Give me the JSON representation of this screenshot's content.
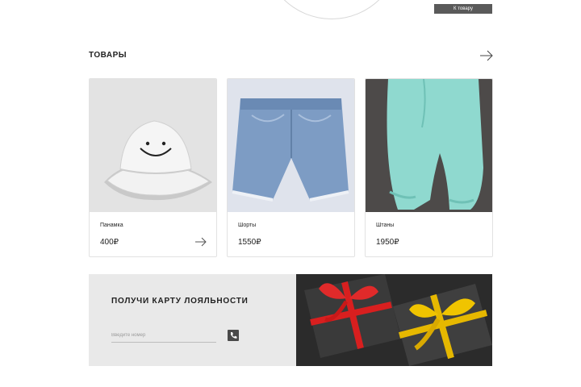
{
  "hero": {
    "button_label": "К товару"
  },
  "products_section": {
    "title": "ТОВАРЫ",
    "items": [
      {
        "name": "Панамка",
        "price": "400₽"
      },
      {
        "name": "Шорты",
        "price": "1550₽"
      },
      {
        "name": "Штаны",
        "price": "1950₽"
      }
    ]
  },
  "loyalty": {
    "title": "ПОЛУЧИ КАРТУ ЛОЯЛЬНОСТИ",
    "phone_placeholder": "Введите номер"
  },
  "colors": {
    "button_dark": "#5a5a5a",
    "loyalty_bg": "#e9e9e9",
    "ribbon_red": "#d81f1f",
    "ribbon_gold": "#e6b800"
  },
  "icons": [
    "arrow-right-icon",
    "phone-icon"
  ]
}
